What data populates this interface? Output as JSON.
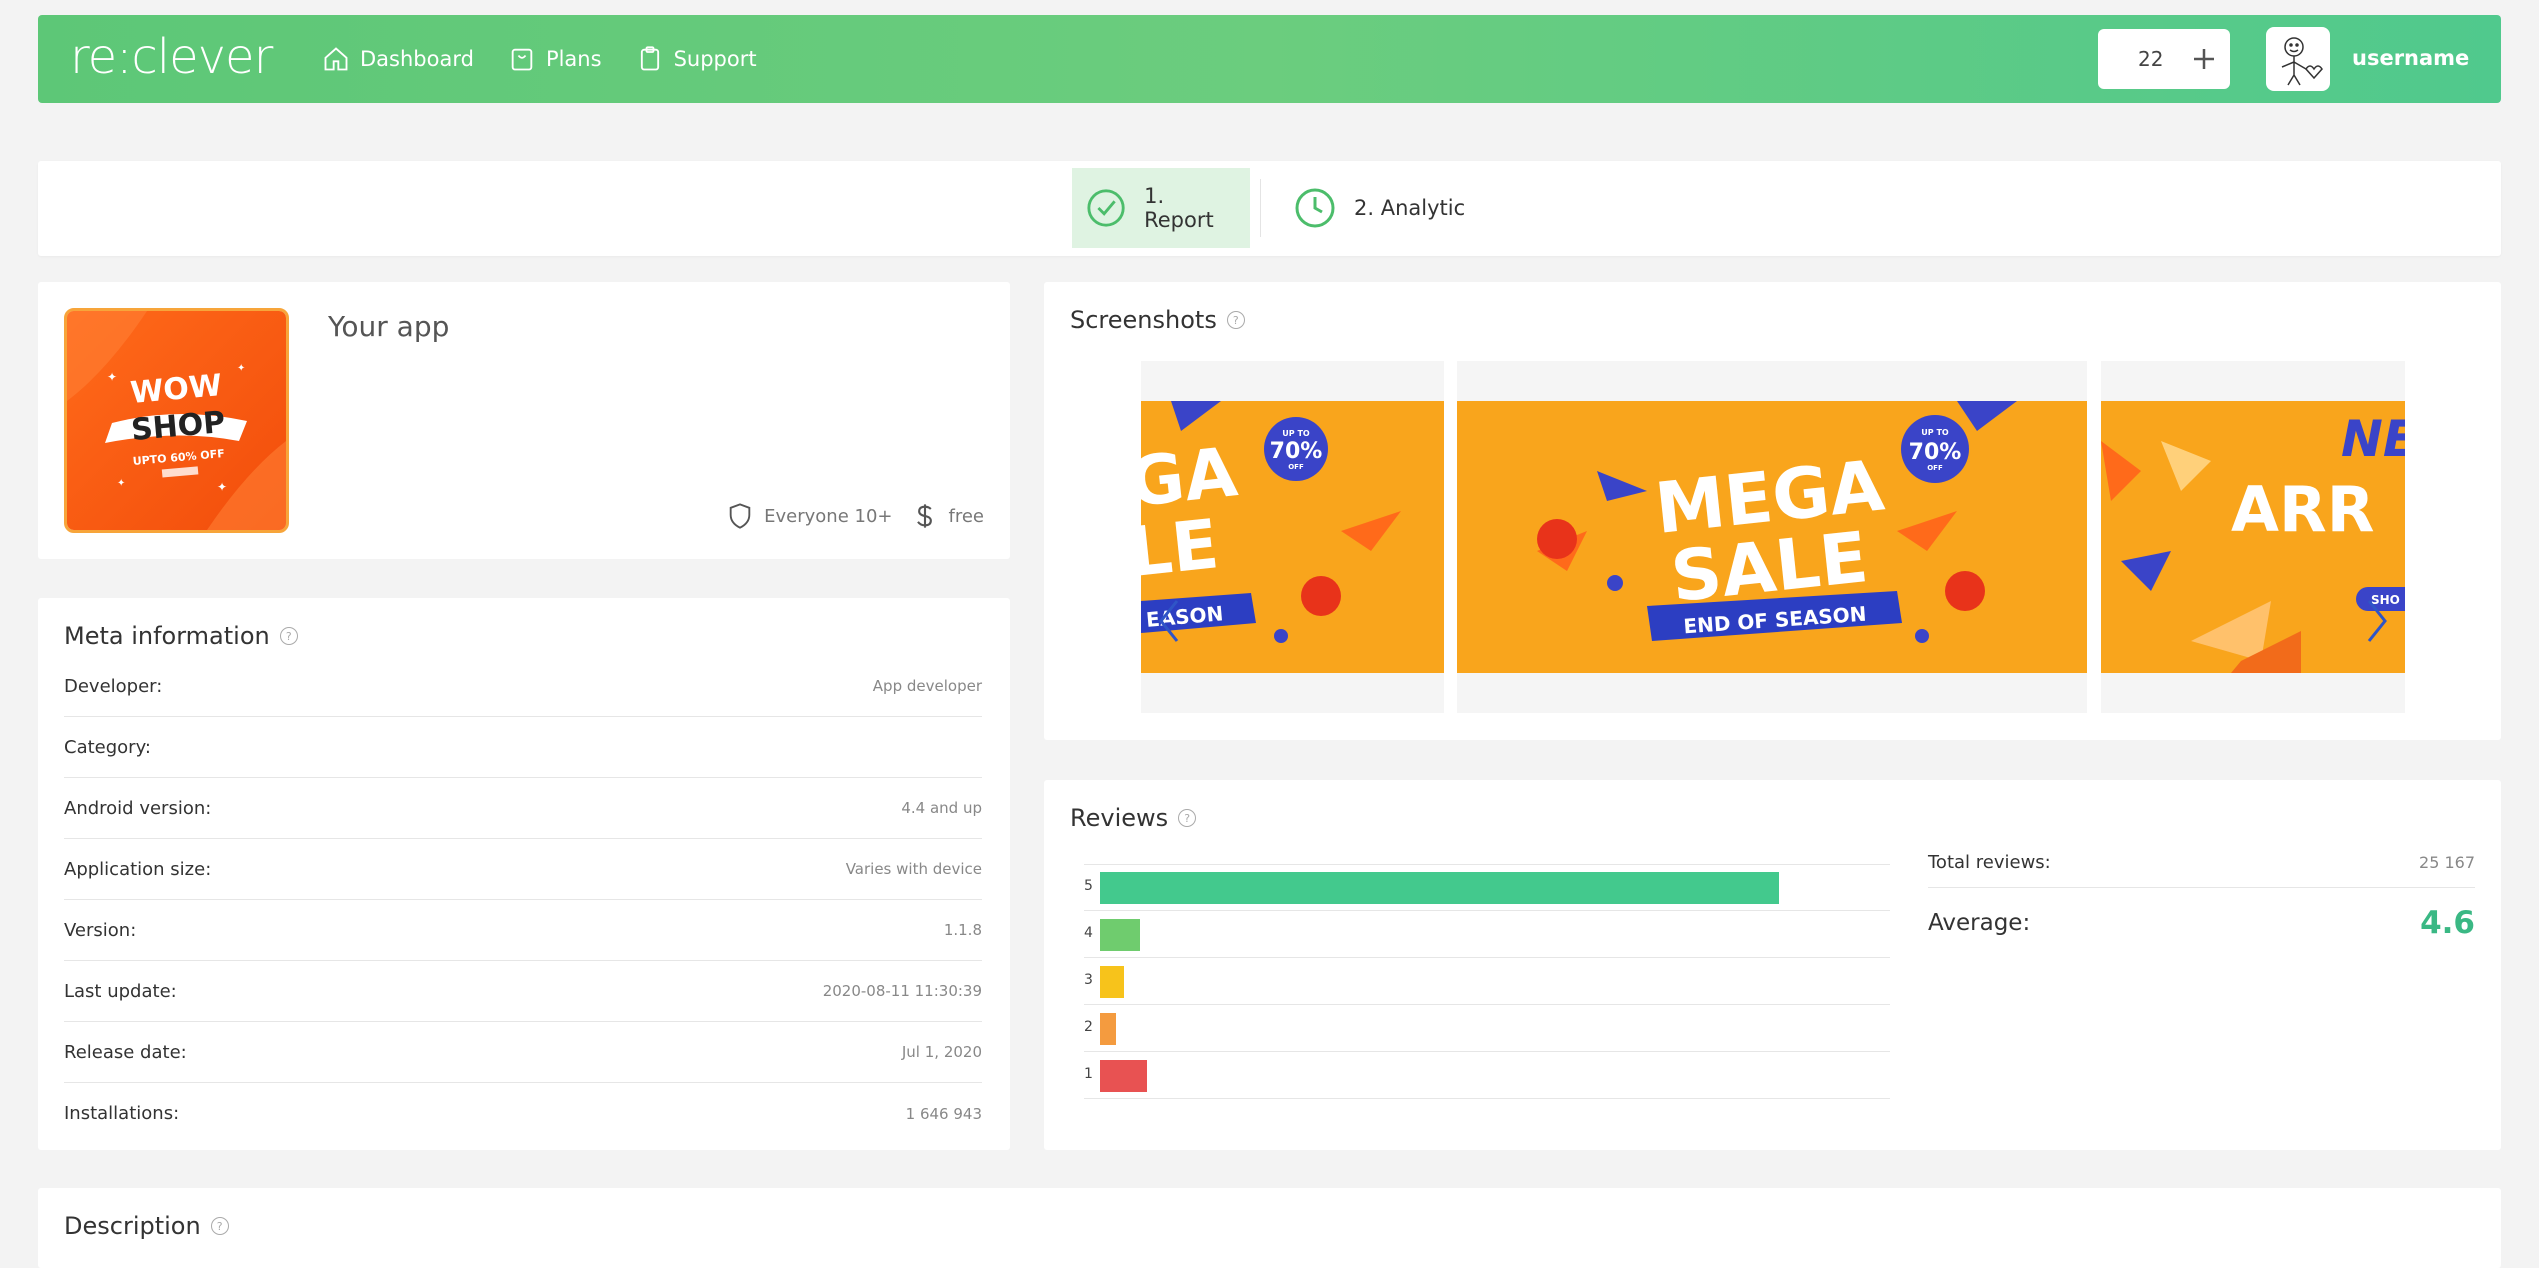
{
  "header": {
    "logo": "re:clever",
    "nav": [
      {
        "label": "Dashboard",
        "icon": "home-icon"
      },
      {
        "label": "Plans",
        "icon": "shopping-bag-icon"
      },
      {
        "label": "Support",
        "icon": "clipboard-icon"
      }
    ],
    "credits": "22",
    "username": "username"
  },
  "steps": [
    {
      "label": "1. Report",
      "icon": "check-circle-icon",
      "active": true
    },
    {
      "label": "2. Analytic",
      "icon": "clock-icon",
      "active": false
    }
  ],
  "app": {
    "name": "Your app",
    "icon_text": {
      "line1": "WOW",
      "line2": "SHOP",
      "line3": "UPTO 60% OFF"
    },
    "rating": "Everyone 10+",
    "price": "free"
  },
  "meta": {
    "title": "Meta information",
    "rows": [
      {
        "label": "Developer:",
        "value": "App developer"
      },
      {
        "label": "Category:",
        "value": ""
      },
      {
        "label": "Android version:",
        "value": "4.4 and up"
      },
      {
        "label": "Application size:",
        "value": "Varies with device"
      },
      {
        "label": "Version:",
        "value": "1.1.8"
      },
      {
        "label": "Last update:",
        "value": "2020-08-11 11:30:39"
      },
      {
        "label": "Release date:",
        "value": "Jul 1, 2020"
      },
      {
        "label": "Installations:",
        "value": "1 646 943"
      }
    ]
  },
  "screenshots": {
    "title": "Screenshots",
    "slides": [
      {
        "big": "GA\nLE",
        "band": "EASON",
        "badge_pct": "70%"
      },
      {
        "big": "MEGA\nSALE",
        "band": "END OF SEASON",
        "badge_pct": "70%"
      },
      {
        "big": "ARR",
        "band": "SHO",
        "badge_pct": ""
      }
    ],
    "badge_top": "UP TO",
    "badge_bottom": "OFF"
  },
  "reviews": {
    "title": "Reviews",
    "total_label": "Total reviews:",
    "total_value": "25 167",
    "average_label": "Average:",
    "average_value": "4.6",
    "colors": {
      "5": "#43c98d",
      "4": "#6fcc6e",
      "3": "#f7c31b",
      "2": "#f49b3f",
      "1": "#e85252"
    }
  },
  "chart_data": {
    "type": "bar",
    "orientation": "horizontal",
    "categories": [
      "5",
      "4",
      "3",
      "2",
      "1"
    ],
    "values": [
      0.86,
      0.05,
      0.03,
      0.02,
      0.06
    ],
    "title": "",
    "xlabel": "",
    "ylabel": ""
  },
  "description": {
    "title": "Description"
  }
}
